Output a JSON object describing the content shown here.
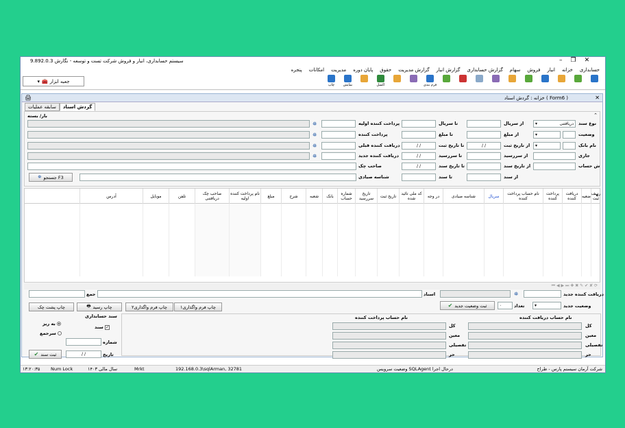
{
  "window": {
    "title": "سیستم حسابداری، انبار و فروش شرکت تست و توسعه - نگارش 9.892.0.3"
  },
  "menu": [
    "حسابداری",
    "خزانه",
    "انبار",
    "فروش",
    "سهام",
    "گزارش حسابداری",
    "گزارش انبار",
    "گزارش مدیریت",
    "حقوق",
    "پایان دوره",
    "مدیریت",
    "امکانات",
    "پنجره"
  ],
  "toolbar": {
    "tools_label": "جعبه ابزار",
    "buttons": [
      {
        "label": "",
        "color": "#2a74c9"
      },
      {
        "label": "",
        "color": "#59a83b"
      },
      {
        "label": "",
        "color": "#e8a638"
      },
      {
        "label": "",
        "color": "#2a74c9"
      },
      {
        "label": "",
        "color": "#59a83b"
      },
      {
        "label": "",
        "color": "#e8a638"
      },
      {
        "label": "",
        "color": "#8a6bb5"
      },
      {
        "label": "",
        "color": "#8aa9c9"
      },
      {
        "label": "",
        "color": "#cc3333"
      },
      {
        "label": "",
        "color": "#59a83b"
      },
      {
        "label": "فرم بندی",
        "color": "#2a74c9"
      },
      {
        "label": "",
        "color": "#8a6bb5"
      },
      {
        "label": "",
        "color": "#e8a638"
      },
      {
        "label": "اکسل",
        "color": "#2f8a3c"
      },
      {
        "label": "",
        "color": "#e8a638"
      },
      {
        "label": "نمایش",
        "color": "#2a74c9"
      },
      {
        "label": "چاپ",
        "color": "#2a74c9"
      }
    ]
  },
  "child": {
    "title": "خزانه : گردش اسناد ( Form6 )",
    "tabs": [
      "گردش اسناد",
      "سابقه عملیات"
    ],
    "section_header": "بار/ بسته"
  },
  "filters": {
    "doc_type_label": "نوع سند",
    "doc_type_value": "دریافتنی",
    "from_serial": "از سریال",
    "to_serial": "تا سریال",
    "status_label": "وضعیت",
    "from_amount": "از مبلغ",
    "to_amount": "تا مبلغ",
    "bank_label": "نام بانک",
    "from_reg_date": "از تاریخ ثبت",
    "to_reg_date": "تا تاریخ ثبت",
    "current_label": "جاری",
    "from_due": "از سررسید",
    "to_due": "تا سررسید",
    "account_label": "ش حساب",
    "from_doc_date": "از تاریخ سند",
    "to_doc_date": "تا تاریخ سند",
    "from_doc": "از سند",
    "to_doc": "تا سند",
    "first_payer": "پرداخت کننده اولیه",
    "payer": "پرداخت کننده",
    "prev_receiver": "دریافت کننده قبلی",
    "new_receiver": "دریافت کننده جدید",
    "check_owner": "صاحب چک",
    "sayadi_id": "شناسه صیادی",
    "date_placeholder": "/   /",
    "search_button": "جستجو F3"
  },
  "grid": {
    "columns": [
      "ردیف ثبت",
      "ضعیه",
      "دریافت کننده",
      "پرداخت کننده",
      "نام حساب پرداخت کننده",
      "سریال",
      "شناسه صیادی",
      "در وجه",
      "کد ملی تائید شده",
      "تاریخ ثبت",
      "تاریخ سررسید",
      "شماره حساب",
      "بانک",
      "شعبه",
      "شرح",
      "مبلغ",
      "نام پرداخت کننده اولیه",
      "صاحب چک دریافتنی",
      "تلفن",
      "موبایل",
      "آدرس"
    ]
  },
  "bottom": {
    "new_receiver": "دریافت کننده جدید",
    "new_status": "وضعیت جدید",
    "count_label": "تعداد",
    "count_value": "۰",
    "register_status_button": "ثبت وضعیت جدید",
    "docs_label": "اسناد",
    "total_label": "جمع",
    "print_form1": "چاپ فرم واگذاری۱",
    "print_form2": "چاپ فرم واگذاری۲",
    "print_receipt": "چاپ رسید",
    "print_back": "چاپ پشت چک",
    "receiver_account": "نام حساب دریافت کننده",
    "payer_account": "نام حساب پرداخت کننده",
    "kol": "کل",
    "moein": "معین",
    "tafsili": "تفصیلی",
    "har": "حر",
    "acc_doc_title": "سند حسابداری",
    "acc_doc_check": "سند",
    "radio_1": "به ریز",
    "radio_2": "سرجمع",
    "number_label": "شماره",
    "date_label": "تاریخ",
    "register_doc_button": "ثبت سند"
  },
  "status": {
    "company": "شرکت آرمان سیستم پارس - طراح",
    "sqlagent": "وضعیت سرویس SQLAgent درحال اجرا",
    "server": "192.168.0.3\\sqlArman, 32781",
    "mrkt": "Mrkt",
    "fiscal_year": "سال مالی ۱۴۰۳",
    "numlock": "Num Lock",
    "time": "۱۳:۲۰:۳۵"
  }
}
